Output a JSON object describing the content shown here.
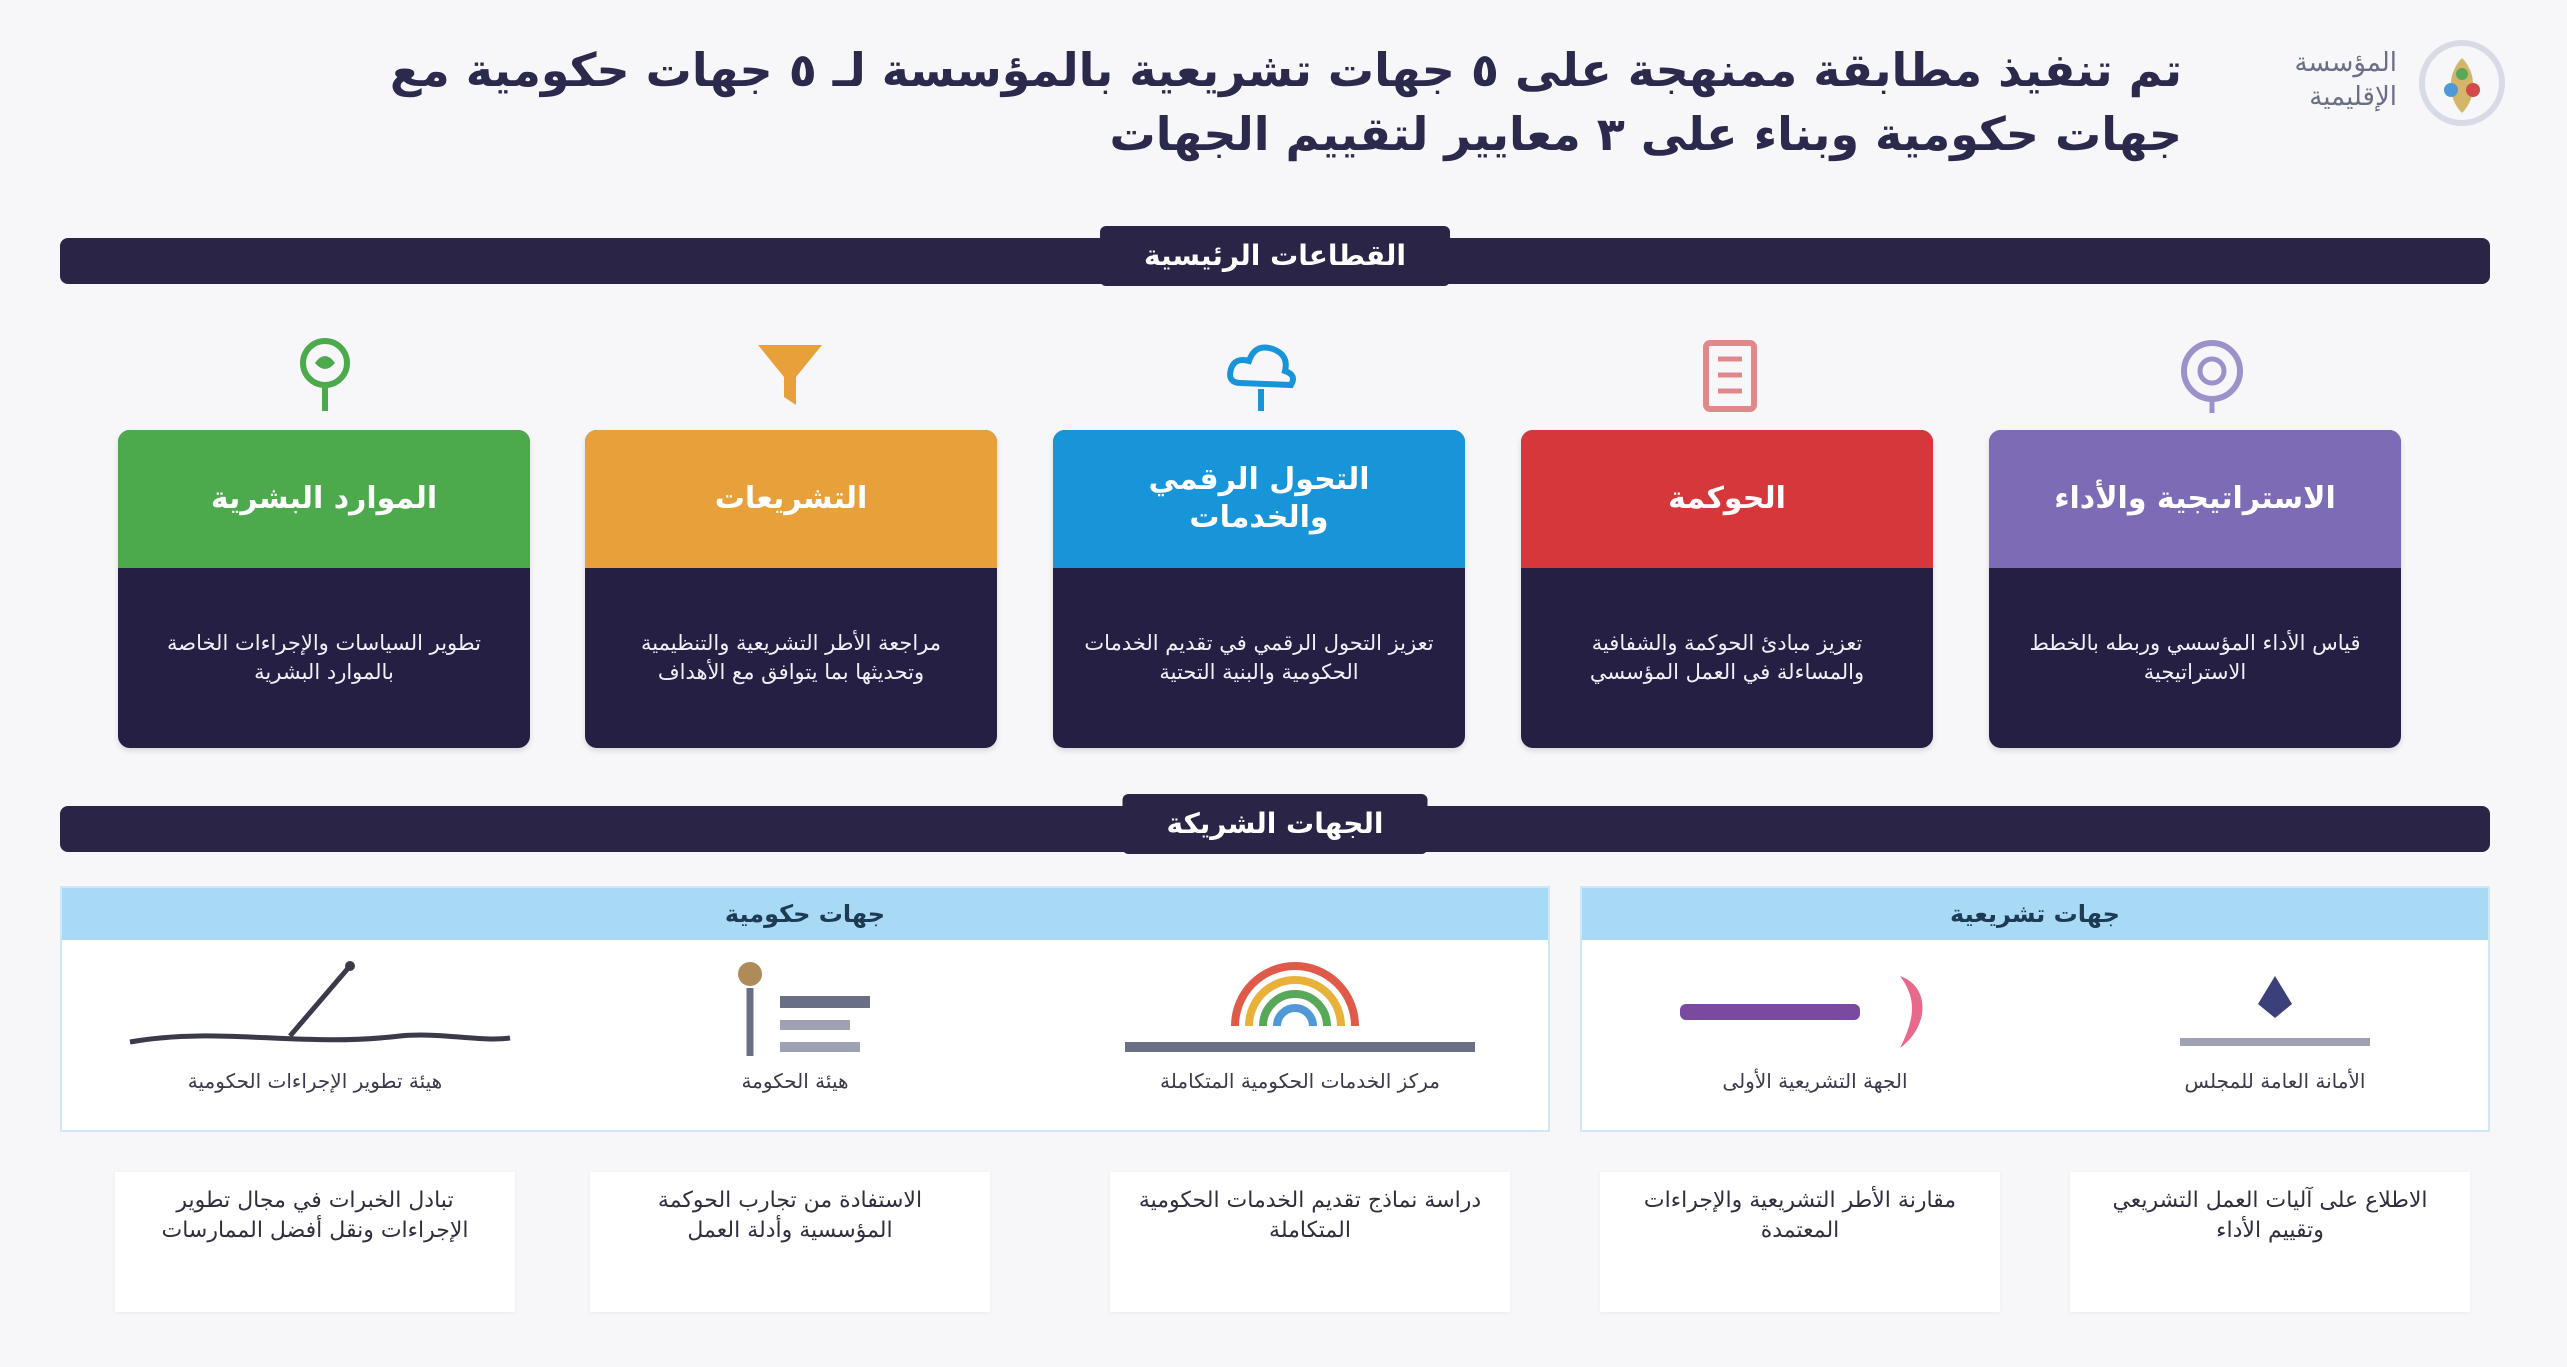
{
  "header": {
    "title": "تم تنفيذ مطابقة ممنهجة على ٥ جهات تشريعية بالمؤسسة لـ ٥ جهات حكومية مع جهات حكومية وبناء على ٣ معايير لتقييم الجهات",
    "logo_text": "المؤسسة الإقليمية"
  },
  "sections": {
    "sectors_label": "القطاعات الرئيسية",
    "partners_label": "الجهات الشريكة"
  },
  "sectors": [
    {
      "title": "الموارد البشرية",
      "desc": "تطوير السياسات والإجراءات الخاصة بالموارد البشرية",
      "color": "#4caa4d",
      "icon": "leaf-icon"
    },
    {
      "title": "التشريعات",
      "desc": "مراجعة الأطر التشريعية والتنظيمية وتحديثها بما يتوافق مع الأهداف",
      "color": "#e7a03a",
      "icon": "funnel-icon"
    },
    {
      "title": "التحول الرقمي والخدمات",
      "desc": "تعزيز التحول الرقمي في تقديم الخدمات الحكومية والبنية التحتية",
      "color": "#1895d8",
      "icon": "cloud-icon"
    },
    {
      "title": "الحوكمة",
      "desc": "تعزيز مبادئ الحوكمة والشفافية والمساءلة في العمل المؤسسي",
      "color": "#d5373b",
      "icon": "building-icon"
    },
    {
      "title": "الاستراتيجية والأداء",
      "desc": "قياس الأداء المؤسسي وربطه بالخطط الاستراتيجية",
      "color": "#7d6bb5",
      "icon": "target-icon"
    }
  ],
  "groups": [
    {
      "label": "جهات حكومية"
    },
    {
      "label": "جهات تشريعية"
    }
  ],
  "partners": [
    {
      "name": "هيئة تطوير الإجراءات الحكومية",
      "logo": "pen-signature-icon"
    },
    {
      "name": "هيئة الحكومة",
      "logo": "person-badge-icon"
    },
    {
      "name": "مركز الخدمات الحكومية المتكاملة",
      "logo": "rainbow-icon"
    },
    {
      "name": "الجهة التشريعية الأولى",
      "logo": "ribbon-icon"
    },
    {
      "name": "الأمانة العامة للمجلس",
      "logo": "emblem-icon"
    }
  ],
  "descriptions": [
    "تبادل الخبرات في مجال تطوير الإجراءات ونقل أفضل الممارسات",
    "الاستفادة من تجارب الحوكمة المؤسسية وأدلة العمل",
    "دراسة نماذج تقديم الخدمات الحكومية المتكاملة",
    "مقارنة الأطر التشريعية والإجراءات المعتمدة",
    "الاطلاع على آليات العمل التشريعي وتقييم الأداء"
  ]
}
